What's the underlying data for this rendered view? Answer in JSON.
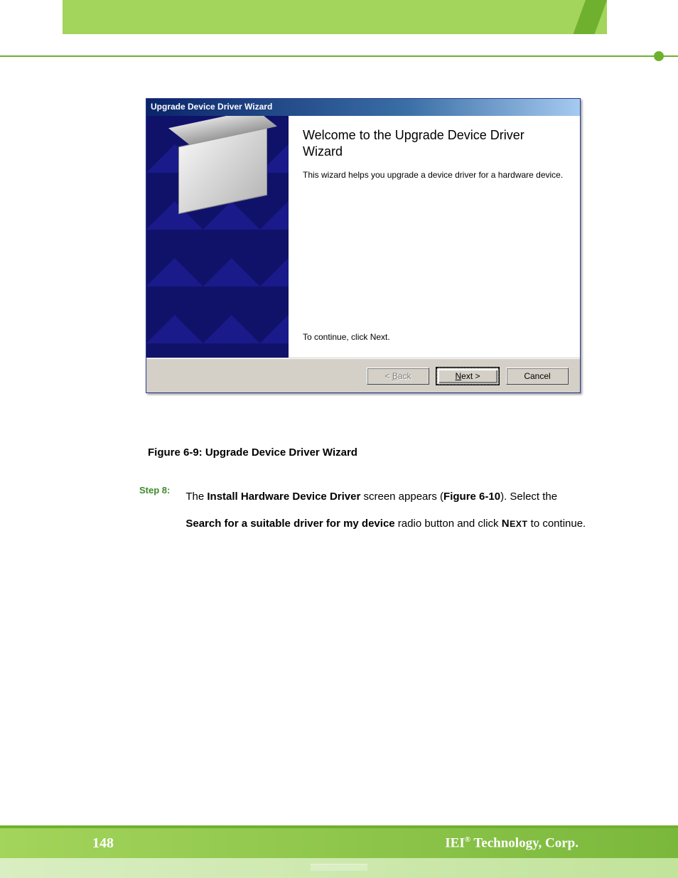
{
  "header": {},
  "dialog": {
    "title": "Upgrade Device Driver Wizard",
    "heading": "Welcome to the Upgrade Device Driver Wizard",
    "body": "This wizard helps you upgrade a device driver for a hardware device.",
    "continue_hint": "To continue, click Next.",
    "buttons": {
      "back_prefix": "< ",
      "back_u": "B",
      "back_rest": "ack",
      "next_u": "N",
      "next_rest": "ext >",
      "cancel": "Cancel"
    }
  },
  "figure_caption": "Figure 6-9: Upgrade Device Driver Wizard",
  "step": {
    "label": "Step 8:",
    "t1": "The ",
    "b1": "Install Hardware Device Driver",
    "t2": " screen appears (",
    "b2": "Figure 6-10",
    "t3": "). Select the ",
    "b3": "Search for a suitable driver for my device",
    "t4": " radio button and click ",
    "sc_n": "N",
    "sc_ext": "EXT",
    "t5": " to continue."
  },
  "footer": {
    "page_number": "148",
    "corp_prefix": "IEI",
    "corp_reg": "®",
    "corp_suffix": " Technology, Corp."
  }
}
